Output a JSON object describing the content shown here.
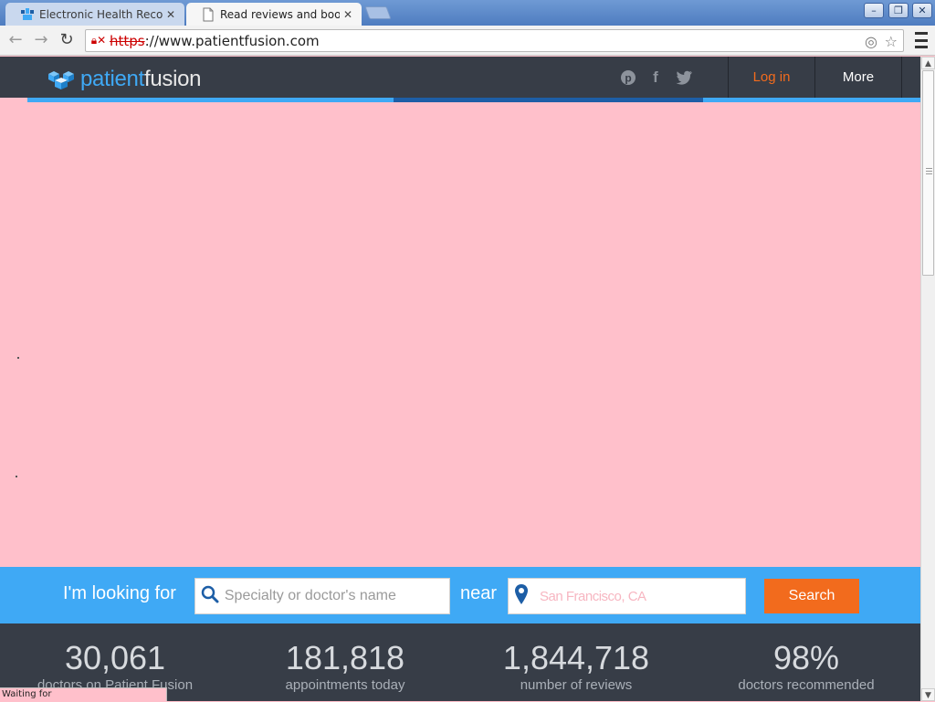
{
  "browser": {
    "tabs": [
      {
        "title": "Electronic Health Recor",
        "favicon": "patientfusion-logo-icon"
      },
      {
        "title": "Read reviews and book",
        "favicon": "page-icon"
      }
    ],
    "url": {
      "scheme": "https",
      "rest": "://www.patientfusion.com"
    },
    "status_text": "Waiting for"
  },
  "header": {
    "logo_part1": "patient",
    "logo_part2": "fusion",
    "login_label": "Log in",
    "more_label": "More",
    "social_icons": [
      "pinterest-icon",
      "facebook-icon",
      "twitter-icon"
    ]
  },
  "search": {
    "looking_for_label": "I'm looking for",
    "specialty_placeholder": "Specialty or doctor's name",
    "near_label": "near",
    "location_value": "San Francisco, CA",
    "button_label": "Search"
  },
  "stats": [
    {
      "value": "30,061",
      "caption": "doctors on Patient Fusion"
    },
    {
      "value": "181,818",
      "caption": "appointments today"
    },
    {
      "value": "1,844,718",
      "caption": "number of reviews"
    },
    {
      "value": "98%",
      "caption": "doctors recommended"
    }
  ],
  "colors": {
    "brand_blue": "#3fa9f5",
    "header_dark": "#373d47",
    "accent_orange": "#f26b1d",
    "placeholder_pink": "#ffc0cb"
  }
}
